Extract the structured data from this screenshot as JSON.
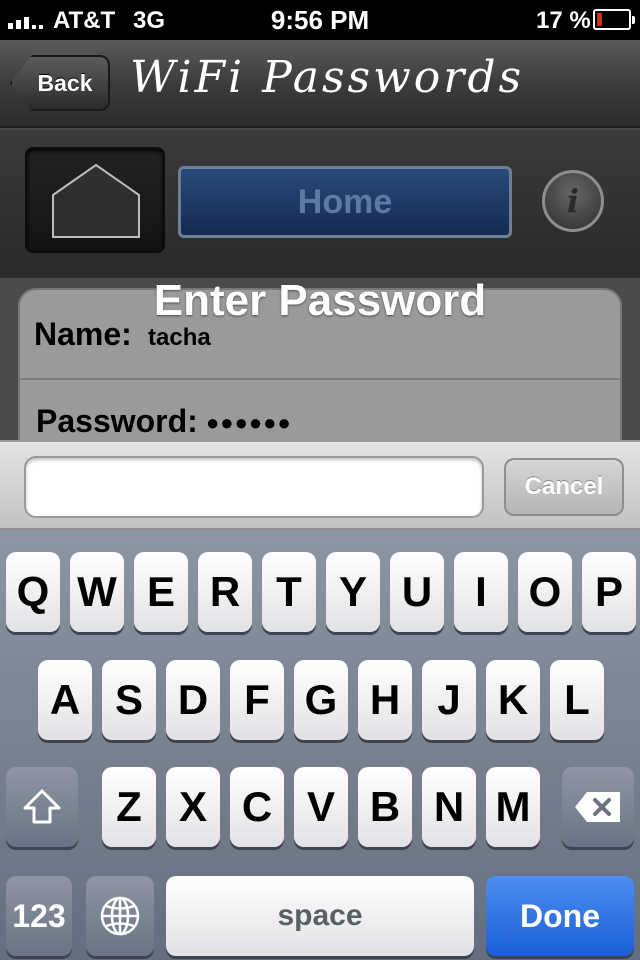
{
  "status_bar": {
    "carrier": "AT&T",
    "network": "3G",
    "time": "9:56 PM",
    "battery_percent": "17 %",
    "battery_level": 0.17,
    "battery_color": "#e5241c"
  },
  "nav": {
    "back_label": "Back",
    "title": "WiFi Passwords"
  },
  "toolbar": {
    "home_label": "Home",
    "info_label": "i",
    "home_icon": "house-outline-icon"
  },
  "dialog": {
    "title": "Enter Password",
    "name_label": "Name:",
    "name_value": "tacha",
    "password_label": "Password:",
    "password_value": "●●●●●●"
  },
  "input_bar": {
    "field_value": "",
    "cancel_label": "Cancel"
  },
  "keyboard": {
    "row1": [
      "Q",
      "W",
      "E",
      "R",
      "T",
      "Y",
      "U",
      "I",
      "O",
      "P"
    ],
    "row2": [
      "A",
      "S",
      "D",
      "F",
      "G",
      "H",
      "J",
      "K",
      "L"
    ],
    "row3": [
      "Z",
      "X",
      "C",
      "V",
      "B",
      "N",
      "M"
    ],
    "shift_icon": "shift-arrow-icon",
    "delete_icon": "backspace-icon",
    "numbers_label": "123",
    "globe_icon": "globe-icon",
    "space_label": "space",
    "done_label": "Done",
    "done_color": "#1a5fd8"
  }
}
